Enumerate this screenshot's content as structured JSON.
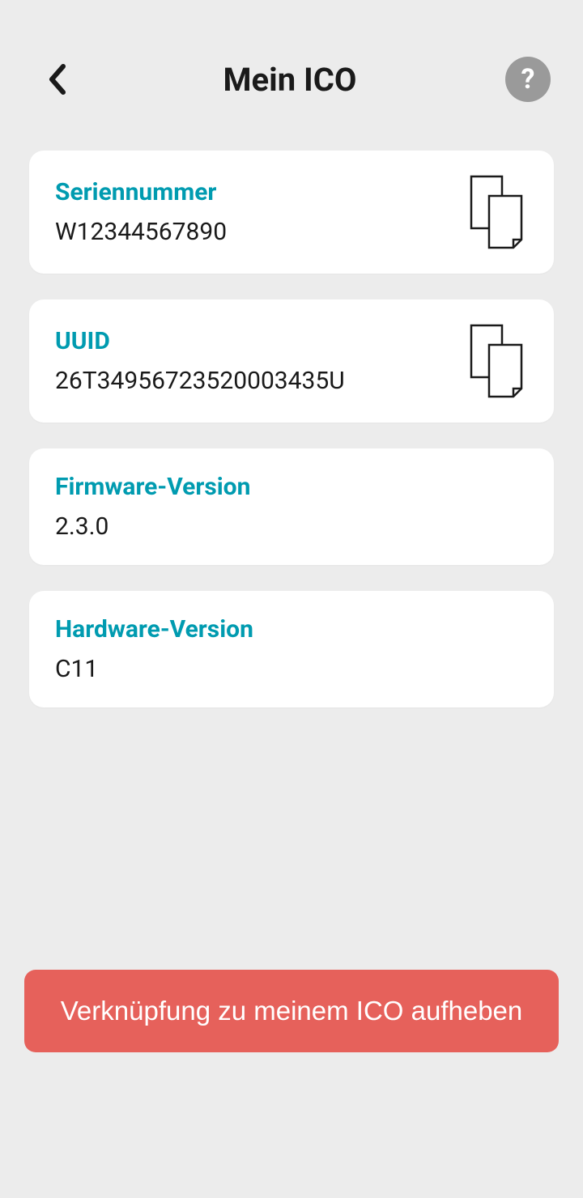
{
  "header": {
    "title": "Mein ICO",
    "help_label": "?"
  },
  "cards": {
    "serial": {
      "label": "Seriennummer",
      "value": "W12344567890"
    },
    "uuid": {
      "label": "UUID",
      "value": "26T34956723520003435U"
    },
    "firmware": {
      "label": "Firmware-Version",
      "value": "2.3.0"
    },
    "hardware": {
      "label": "Hardware-Version",
      "value": "C11"
    }
  },
  "actions": {
    "unlink_label": "Verknüpfung zu meinem ICO aufheben"
  }
}
